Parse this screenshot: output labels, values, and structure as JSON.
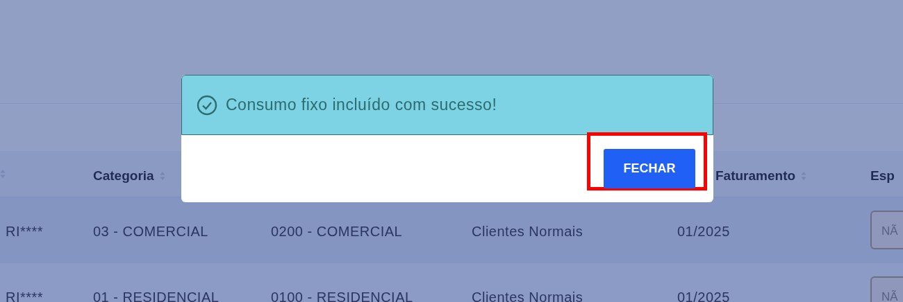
{
  "table": {
    "columns": [
      {
        "sortable": true
      },
      {
        "label": "Categoria",
        "sortable": true
      },
      {},
      {},
      {
        "label": "Faturamento",
        "sortable": true
      },
      {
        "label": "Esp"
      }
    ],
    "rows": [
      {
        "cells": [
          "RI****",
          "03 - COMERCIAL",
          "0200 - COMERCIAL",
          "Clientes Normais",
          "01/2025"
        ],
        "select": "NÃ"
      },
      {
        "cells": [
          "RI****",
          "01 - RESIDENCIAL",
          "0100 - RESIDENCIAL",
          "Clientes Normais",
          "01/2025"
        ],
        "select": "NÃ"
      }
    ]
  },
  "dialog": {
    "message": "Consumo fixo incluído com sucesso!",
    "button": {
      "label": "FECHAR",
      "highlighted": true
    }
  }
}
